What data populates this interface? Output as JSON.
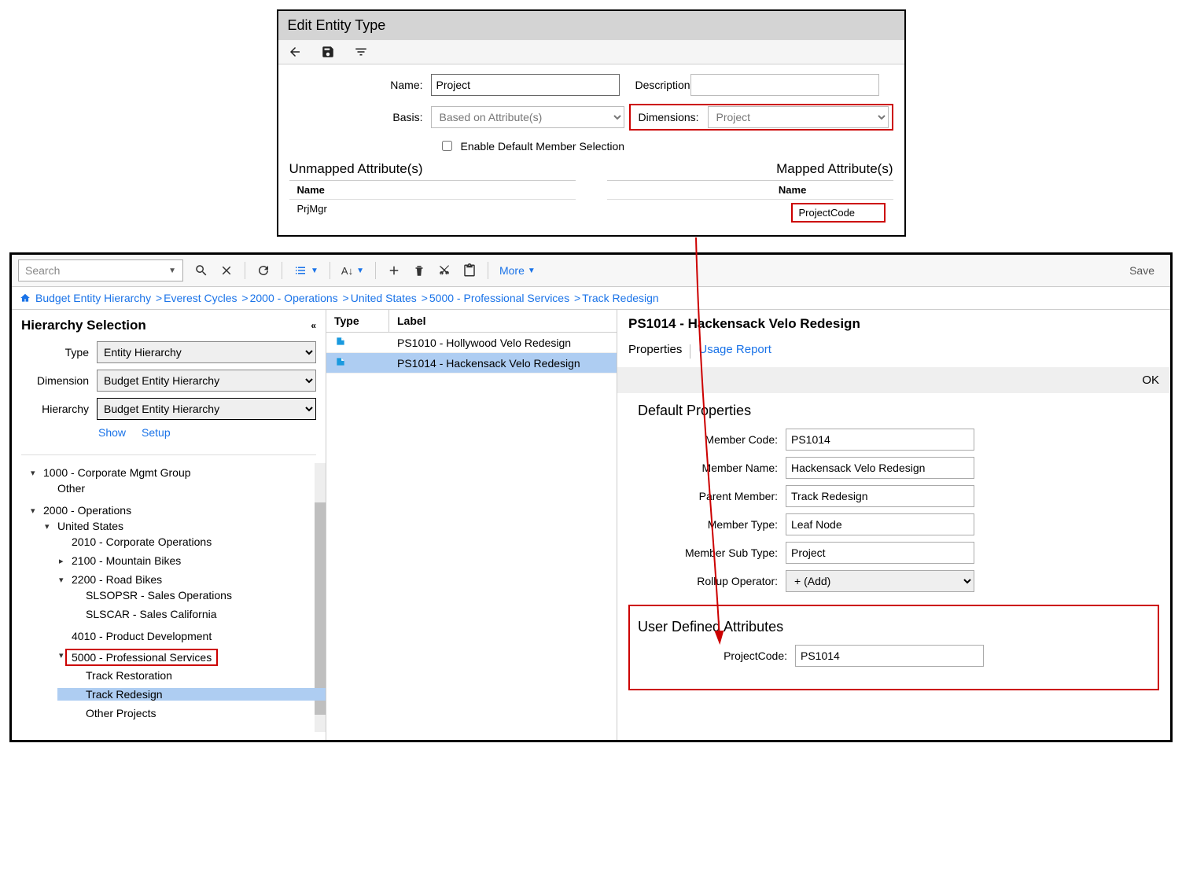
{
  "dialog": {
    "title": "Edit Entity Type",
    "fields": {
      "name_label": "Name:",
      "name_value": "Project",
      "basis_label": "Basis:",
      "basis_value": "Based on Attribute(s)",
      "description_label": "Description:",
      "description_value": "",
      "dimensions_label": "Dimensions:",
      "dimensions_value": "Project",
      "enable_default_label": "Enable Default Member Selection"
    },
    "unmapped": {
      "heading": "Unmapped Attribute(s)",
      "name_hdr": "Name",
      "row": "PrjMgr"
    },
    "mapped": {
      "heading": "Mapped Attribute(s)",
      "name_hdr": "Name",
      "row": "ProjectCode"
    }
  },
  "toolbar": {
    "search_placeholder": "Search",
    "more_label": "More",
    "save_label": "Save"
  },
  "breadcrumbs": {
    "items": [
      "Budget Entity Hierarchy",
      "Everest Cycles",
      "2000 - Operations",
      "United States",
      "5000 - Professional Services",
      "Track Redesign"
    ]
  },
  "sidebar": {
    "heading": "Hierarchy Selection",
    "type_label": "Type",
    "type_value": "Entity Hierarchy",
    "dimension_label": "Dimension",
    "dimension_value": "Budget Entity Hierarchy",
    "hierarchy_label": "Hierarchy",
    "hierarchy_value": "Budget Entity Hierarchy",
    "show_link": "Show",
    "setup_link": "Setup",
    "tree": {
      "n_corp": "1000 - Corporate Mgmt Group",
      "n_other": "Other",
      "n_ops": "2000 - Operations",
      "n_us": "United States",
      "n_2010": "2010 - Corporate Operations",
      "n_2100": "2100 - Mountain Bikes",
      "n_2200": "2200 - Road Bikes",
      "n_slsopsr": "SLSOPSR - Sales Operations",
      "n_slscar": "SLSCAR - Sales California",
      "n_4010": "4010 - Product Development",
      "n_5000": "5000 - Professional Services",
      "n_trkrest": "Track Restoration",
      "n_trkred": "Track Redesign",
      "n_otherproj": "Other Projects"
    }
  },
  "mid": {
    "type_hdr": "Type",
    "label_hdr": "Label",
    "rows": [
      {
        "label": "PS1010 - Hollywood Velo Redesign",
        "selected": false
      },
      {
        "label": "PS1014 - Hackensack Velo Redesign",
        "selected": true
      }
    ]
  },
  "right": {
    "title": "PS1014 - Hackensack Velo Redesign",
    "tab_properties": "Properties",
    "tab_usage": "Usage Report",
    "ok_label": "OK",
    "default_heading": "Default Properties",
    "props": {
      "member_code_label": "Member Code:",
      "member_code_value": "PS1014",
      "member_name_label": "Member Name:",
      "member_name_value": "Hackensack Velo Redesign",
      "parent_member_label": "Parent Member:",
      "parent_member_value": "Track Redesign",
      "member_type_label": "Member Type:",
      "member_type_value": "Leaf Node",
      "member_subtype_label": "Member Sub Type:",
      "member_subtype_value": "Project",
      "rollup_label": "Rollup Operator:",
      "rollup_value": "+ (Add)"
    },
    "uda_heading": "User Defined Attributes",
    "uda": {
      "projectcode_label": "ProjectCode:",
      "projectcode_value": "PS1014"
    }
  }
}
